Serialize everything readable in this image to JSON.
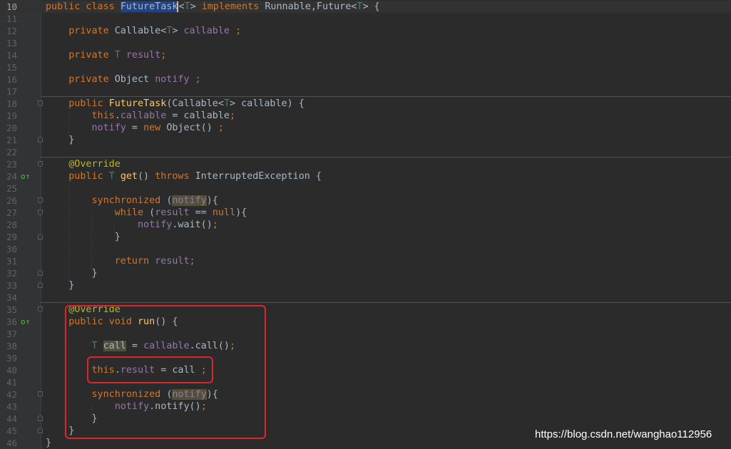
{
  "editor": {
    "lines": [
      {
        "n": "10",
        "current": true,
        "fold": "",
        "mark": false,
        "tokens": [
          {
            "t": "public class ",
            "c": "kw"
          },
          {
            "t": "FutureTask",
            "c": "sel"
          },
          {
            "t": "",
            "c": "caret"
          },
          {
            "t": "<",
            "c": ""
          },
          {
            "t": "T",
            "c": "tp"
          },
          {
            "t": "> ",
            "c": ""
          },
          {
            "t": "implements ",
            "c": "kw"
          },
          {
            "t": "Runnable,Future<",
            "c": ""
          },
          {
            "t": "T",
            "c": "tp"
          },
          {
            "t": "> {",
            "c": ""
          }
        ]
      },
      {
        "n": "11",
        "tokens": []
      },
      {
        "n": "12",
        "tokens": [
          {
            "t": "    private ",
            "c": "kw"
          },
          {
            "t": "Callable<",
            "c": ""
          },
          {
            "t": "T",
            "c": "tp"
          },
          {
            "t": "> ",
            "c": ""
          },
          {
            "t": "callable ",
            "c": "fld"
          },
          {
            "t": ";",
            "c": "kw"
          }
        ]
      },
      {
        "n": "13",
        "tokens": []
      },
      {
        "n": "14",
        "tokens": [
          {
            "t": "    private ",
            "c": "kw"
          },
          {
            "t": "T ",
            "c": "tp"
          },
          {
            "t": "result",
            "c": "fld"
          },
          {
            "t": ";",
            "c": "kw"
          }
        ]
      },
      {
        "n": "15",
        "tokens": []
      },
      {
        "n": "16",
        "tokens": [
          {
            "t": "    private ",
            "c": "kw"
          },
          {
            "t": "Object ",
            "c": ""
          },
          {
            "t": "notify ",
            "c": "fld"
          },
          {
            "t": ";",
            "c": "kw"
          }
        ]
      },
      {
        "n": "17",
        "tokens": []
      },
      {
        "n": "18",
        "fold": "open",
        "tokens": [
          {
            "t": "    public ",
            "c": "kw"
          },
          {
            "t": "FutureTask",
            "c": "fn"
          },
          {
            "t": "(Callable<",
            "c": ""
          },
          {
            "t": "T",
            "c": "tp"
          },
          {
            "t": "> callable) {",
            "c": ""
          }
        ]
      },
      {
        "n": "19",
        "tokens": [
          {
            "t": "        this",
            "c": "kw"
          },
          {
            "t": ".",
            "c": ""
          },
          {
            "t": "callable",
            "c": "fld"
          },
          {
            "t": " = callable",
            "c": ""
          },
          {
            "t": ";",
            "c": "kw"
          }
        ]
      },
      {
        "n": "20",
        "tokens": [
          {
            "t": "        notify",
            "c": "fld"
          },
          {
            "t": " = ",
            "c": ""
          },
          {
            "t": "new ",
            "c": "kw"
          },
          {
            "t": "Object() ",
            "c": ""
          },
          {
            "t": ";",
            "c": "kw"
          }
        ]
      },
      {
        "n": "21",
        "fold": "close",
        "tokens": [
          {
            "t": "    }",
            "c": ""
          }
        ]
      },
      {
        "n": "22",
        "tokens": []
      },
      {
        "n": "23",
        "fold": "open",
        "tokens": [
          {
            "t": "    @Override",
            "c": "ann"
          }
        ]
      },
      {
        "n": "24",
        "mark": true,
        "tokens": [
          {
            "t": "    public ",
            "c": "kw"
          },
          {
            "t": "T ",
            "c": "tp"
          },
          {
            "t": "get",
            "c": "fn"
          },
          {
            "t": "() ",
            "c": ""
          },
          {
            "t": "throws ",
            "c": "kw"
          },
          {
            "t": "InterruptedException {",
            "c": ""
          }
        ]
      },
      {
        "n": "25",
        "tokens": []
      },
      {
        "n": "26",
        "fold": "open",
        "tokens": [
          {
            "t": "        synchronized ",
            "c": "kw"
          },
          {
            "t": "(",
            "c": ""
          },
          {
            "t": "notify",
            "c": "fld hl"
          },
          {
            "t": "){",
            "c": ""
          }
        ]
      },
      {
        "n": "27",
        "fold": "open",
        "tokens": [
          {
            "t": "            while ",
            "c": "kw"
          },
          {
            "t": "(",
            "c": ""
          },
          {
            "t": "result",
            "c": "fld"
          },
          {
            "t": " == ",
            "c": ""
          },
          {
            "t": "null",
            "c": "kw"
          },
          {
            "t": "){",
            "c": ""
          }
        ]
      },
      {
        "n": "28",
        "tokens": [
          {
            "t": "                notify",
            "c": "fld"
          },
          {
            "t": ".wait()",
            "c": ""
          },
          {
            "t": ";",
            "c": "kw"
          }
        ]
      },
      {
        "n": "29",
        "fold": "close",
        "tokens": [
          {
            "t": "            }",
            "c": ""
          }
        ]
      },
      {
        "n": "30",
        "tokens": []
      },
      {
        "n": "31",
        "tokens": [
          {
            "t": "            return ",
            "c": "kw"
          },
          {
            "t": "result",
            "c": "fld"
          },
          {
            "t": ";",
            "c": "kw"
          }
        ]
      },
      {
        "n": "32",
        "fold": "close",
        "tokens": [
          {
            "t": "        }",
            "c": ""
          }
        ]
      },
      {
        "n": "33",
        "fold": "close",
        "tokens": [
          {
            "t": "    }",
            "c": ""
          }
        ]
      },
      {
        "n": "34",
        "tokens": []
      },
      {
        "n": "35",
        "fold": "open",
        "tokens": [
          {
            "t": "    @Override",
            "c": "ann"
          }
        ]
      },
      {
        "n": "36",
        "mark": true,
        "tokens": [
          {
            "t": "    public ",
            "c": "kw"
          },
          {
            "t": "void ",
            "c": "kw"
          },
          {
            "t": "run",
            "c": "fn"
          },
          {
            "t": "() {",
            "c": ""
          }
        ]
      },
      {
        "n": "37",
        "tokens": []
      },
      {
        "n": "38",
        "tokens": [
          {
            "t": "        T ",
            "c": "tp"
          },
          {
            "t": "call",
            "c": "hl"
          },
          {
            "t": " = ",
            "c": ""
          },
          {
            "t": "callable",
            "c": "fld"
          },
          {
            "t": ".call()",
            "c": ""
          },
          {
            "t": ";",
            "c": "kw"
          }
        ]
      },
      {
        "n": "39",
        "tokens": []
      },
      {
        "n": "40",
        "tokens": [
          {
            "t": "        this",
            "c": "kw"
          },
          {
            "t": ".",
            "c": ""
          },
          {
            "t": "result",
            "c": "fld"
          },
          {
            "t": " = call ",
            "c": ""
          },
          {
            "t": ";",
            "c": "kw"
          }
        ]
      },
      {
        "n": "41",
        "tokens": []
      },
      {
        "n": "42",
        "fold": "open",
        "tokens": [
          {
            "t": "        synchronized ",
            "c": "kw"
          },
          {
            "t": "(",
            "c": ""
          },
          {
            "t": "notify",
            "c": "fld hl"
          },
          {
            "t": "){",
            "c": ""
          }
        ]
      },
      {
        "n": "43",
        "tokens": [
          {
            "t": "            notify",
            "c": "fld"
          },
          {
            "t": ".notify()",
            "c": ""
          },
          {
            "t": ";",
            "c": "kw"
          }
        ]
      },
      {
        "n": "44",
        "fold": "close",
        "tokens": [
          {
            "t": "        }",
            "c": ""
          }
        ]
      },
      {
        "n": "45",
        "fold": "close",
        "tokens": [
          {
            "t": "    }",
            "c": ""
          }
        ]
      },
      {
        "n": "46",
        "tokens": [
          {
            "t": "}",
            "c": ""
          }
        ]
      }
    ]
  },
  "watermark": "https://blog.csdn.net/wanghao112956",
  "colors": {
    "background": "#2b2b2b",
    "keyword": "#cc7832",
    "field": "#9876aa",
    "method": "#ffc66d",
    "annotation": "#bbb529",
    "highlight_box": "#e0242d"
  }
}
